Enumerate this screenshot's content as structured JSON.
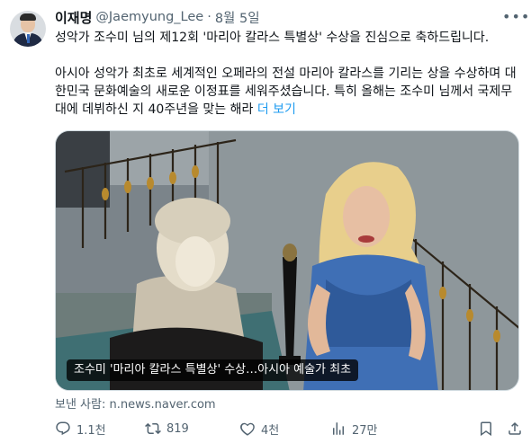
{
  "author": {
    "name": "이재명",
    "handle": "@Jaemyung_Lee",
    "separator": "·",
    "date": "8월 5일"
  },
  "tweet": {
    "paragraph1": "성악가 조수미 님의 제12회 '마리아 칼라스 특별상' 수상을 진심으로 축하드립니다.",
    "paragraph2": "아시아 성악가 최초로 세계적인 오페라의 전설 마리아 칼라스를 기리는 상을 수상하며 대한민국 문화예술의 새로운 이정표를 세워주셨습니다. 특히 올해는 조수미 님께서 국제무대에 데뷔하신 지 40주년을 맞는 해라",
    "show_more": "더 보기"
  },
  "media": {
    "caption": "조수미 '마리아 칼라스 특별상' 수상…아시아 예술가 최초",
    "source_label": "보낸 사람:",
    "source_domain": "n.news.naver.com"
  },
  "actions": {
    "reply_count": "1.1천",
    "retweet_count": "819",
    "like_count": "4천",
    "view_count": "27만"
  },
  "icons": {
    "more": "more-horizontal-icon",
    "reply": "reply-icon",
    "retweet": "retweet-icon",
    "like": "heart-icon",
    "views": "bar-chart-icon",
    "bookmark": "bookmark-icon",
    "share": "share-icon"
  },
  "colors": {
    "link": "#1d9bf0",
    "secondary_text": "#536471",
    "primary_text": "#0f1419"
  }
}
